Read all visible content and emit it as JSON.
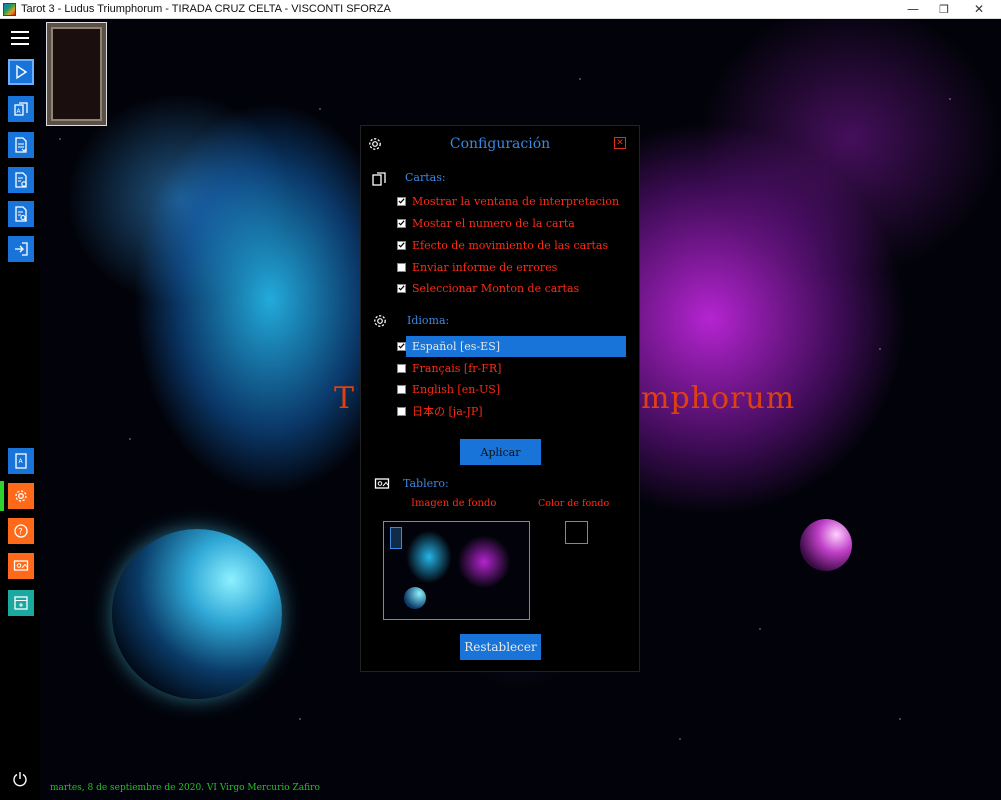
{
  "window": {
    "title": "Tarot 3 - Ludus Triumphorum - TIRADA CRUZ CELTA - VISCONTI SFORZA",
    "minimize": "—",
    "restore": "❐",
    "close": "✕"
  },
  "sidebar": {
    "top_buttons": [
      {
        "icon": "play-icon",
        "color": "#1874d8"
      },
      {
        "icon": "cards-icon",
        "color": "#1874d8"
      },
      {
        "icon": "document-download-icon",
        "color": "#1874d8"
      },
      {
        "icon": "document-settings-icon",
        "color": "#1874d8"
      },
      {
        "icon": "document-search-icon",
        "color": "#1874d8"
      },
      {
        "icon": "exit-icon",
        "color": "#1874d8"
      }
    ],
    "bottom_buttons": [
      {
        "icon": "card-icon",
        "color": "#1874d8"
      },
      {
        "icon": "gear-icon",
        "color": "#ff6a1a",
        "active": true
      },
      {
        "icon": "help-icon",
        "color": "#ff6a1a"
      },
      {
        "icon": "board-icon",
        "color": "#ff6a1a"
      },
      {
        "icon": "calendar-icon",
        "color": "#1aa8a0"
      }
    ]
  },
  "background_title": {
    "left": "T",
    "right": "mphorum"
  },
  "status": {
    "date": "martes, 8 de septiembre de 2020. VI Virgo Mercurio Zafiro"
  },
  "config_panel": {
    "title": "Configuración",
    "close_label": "✕",
    "cards_section": {
      "label": "Cartas:",
      "options": [
        {
          "label": "Mostrar la ventana de interpretacion",
          "checked": true
        },
        {
          "label": "Mostar el numero de la carta",
          "checked": true
        },
        {
          "label": "Efecto de movimiento de las cartas",
          "checked": true
        },
        {
          "label": "Enviar informe de errores",
          "checked": false
        },
        {
          "label": "Seleccionar Monton de cartas",
          "checked": true
        }
      ]
    },
    "language_section": {
      "label": "Idioma:",
      "options": [
        {
          "label": "Español [es-ES]",
          "checked": true,
          "selected": true
        },
        {
          "label": "Français [fr-FR]",
          "checked": false
        },
        {
          "label": "English [en-US]",
          "checked": false
        },
        {
          "label": "日本の [ja-JP]",
          "checked": false
        }
      ]
    },
    "apply_label": "Aplicar",
    "board_section": {
      "label": "Tablero:",
      "background_image_label": "Imagen de fondo",
      "background_color_label": "Color de fondo",
      "background_color": "#000000"
    },
    "reset_label": "Restablecer"
  },
  "colors": {
    "accent_blue": "#1874d8",
    "label_blue": "#3a88e0",
    "option_red": "#ff2a14",
    "orange": "#ff6a1a",
    "teal": "#1aa8a0",
    "status_green": "#22c022"
  }
}
